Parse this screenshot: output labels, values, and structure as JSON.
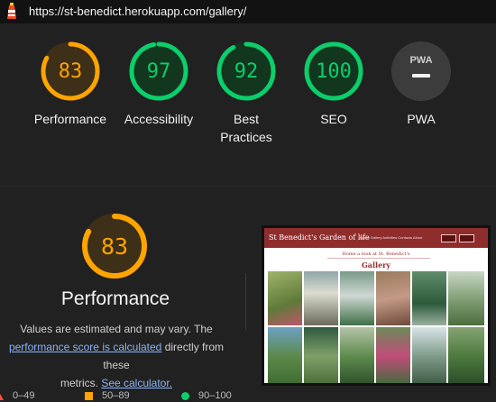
{
  "browser": {
    "url": "https://st-benedict.herokuapp.com/gallery/"
  },
  "colors": {
    "average": "#ffa400",
    "average_bg": "#3d2f18",
    "pass": "#0cce6b",
    "pass_bg": "#13361f",
    "pwa_bg": "#3c3c3c"
  },
  "scores": [
    {
      "label": "Performance",
      "value": "83",
      "score": 83,
      "status": "average"
    },
    {
      "label": "Accessibility",
      "value": "97",
      "score": 97,
      "status": "pass"
    },
    {
      "label": "Best Practices",
      "value": "92",
      "score": 92,
      "status": "pass"
    },
    {
      "label": "SEO",
      "value": "100",
      "score": 100,
      "status": "pass"
    },
    {
      "label": "PWA",
      "value": "PWA",
      "status": "na"
    }
  ],
  "performance": {
    "score": "83",
    "title": "Performance",
    "desc_1": "Values are estimated and may vary. The",
    "link_score": "performance score is calculated",
    "desc_2": "directly from these",
    "desc_3": "metrics.",
    "link_calc": "See calculator."
  },
  "legend": [
    {
      "range": "0–49",
      "shape": "triangle",
      "color": "#ff4e42"
    },
    {
      "range": "50–89",
      "shape": "square",
      "color": "#ffa400"
    },
    {
      "range": "90–100",
      "shape": "circle",
      "color": "#0cce6b"
    }
  ],
  "screenshot": {
    "brand": "St Benedict's Garden of life",
    "nav_links": "Home  Gallery  Activities  Contacts  About",
    "subtitle": "Home a look at St. Benedict's",
    "heading": "Gallery"
  }
}
